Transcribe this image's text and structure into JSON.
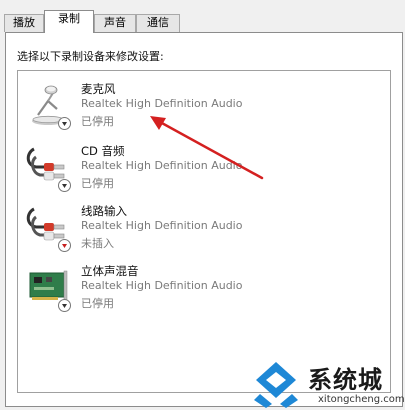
{
  "tabs": [
    {
      "label": "播放",
      "active": false
    },
    {
      "label": "录制",
      "active": true
    },
    {
      "label": "声音",
      "active": false
    },
    {
      "label": "通信",
      "active": false
    }
  ],
  "instruction": "选择以下录制设备来修改设置:",
  "devices": [
    {
      "name": "麦克风",
      "description": "Realtek High Definition Audio",
      "status": "已停用",
      "icon": "microphone-icon",
      "badge": "disabled-down-arrow-icon"
    },
    {
      "name": "CD 音频",
      "description": "Realtek High Definition Audio",
      "status": "已停用",
      "icon": "rca-cable-icon",
      "badge": "disabled-down-arrow-icon"
    },
    {
      "name": "线路输入",
      "description": "Realtek High Definition Audio",
      "status": "未插入",
      "icon": "rca-cable-icon",
      "badge": "unplugged-down-arrow-icon"
    },
    {
      "name": "立体声混音",
      "description": "Realtek High Definition Audio",
      "status": "已停用",
      "icon": "sound-card-icon",
      "badge": "disabled-down-arrow-icon"
    }
  ],
  "watermark": {
    "title": "系统城",
    "url": "xitongcheng.com"
  },
  "colors": {
    "annotation_arrow": "#d42020",
    "watermark_blue": "#1e88d6"
  }
}
